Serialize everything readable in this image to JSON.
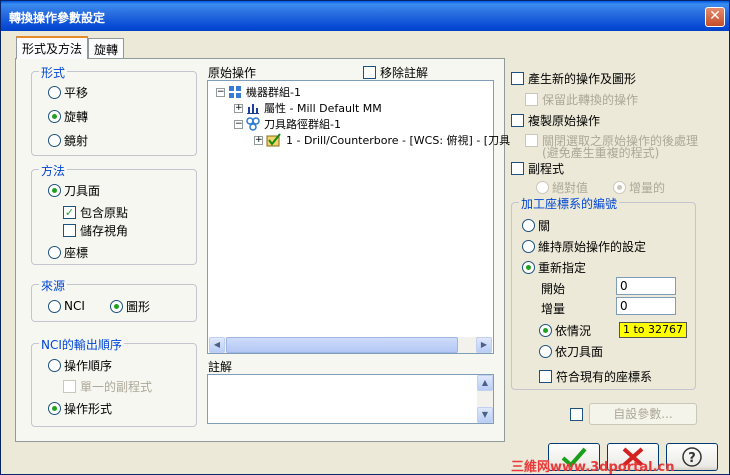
{
  "window": {
    "title": "轉換操作參數設定",
    "close_label": "✕"
  },
  "tabs": [
    {
      "label": "形式及方法"
    },
    {
      "label": "旋轉"
    }
  ],
  "form_group": {
    "title": "形式",
    "options": [
      {
        "label": "平移",
        "selected": false
      },
      {
        "label": "旋轉",
        "selected": true
      },
      {
        "label": "鏡射",
        "selected": false
      }
    ]
  },
  "method_group": {
    "title": "方法",
    "tool_plane": "刀具面",
    "include_origin": "包含原點",
    "save_view": "儲存視角",
    "coords": "座標"
  },
  "source_group": {
    "title": "來源",
    "nci": "NCI",
    "graphics": "圖形"
  },
  "nci_order_group": {
    "title": "NCI的輸出順序",
    "op_order": "操作順序",
    "single_subprogram": "單一的副程式",
    "op_form": "操作形式"
  },
  "original_ops": {
    "label": "原始操作",
    "remove_notes": "移除註解",
    "tree": [
      {
        "text": "機器群組-1",
        "icon": "machine-group-icon"
      },
      {
        "text": "屬性 - Mill Default MM",
        "icon": "properties-icon"
      },
      {
        "text": "刀具路徑群組-1",
        "icon": "toolpath-group-icon"
      },
      {
        "text": "1 - Drill/Counterbore - [WCS: 俯視] - [刀具",
        "icon": "operation-icon"
      }
    ]
  },
  "notes": {
    "label": "註解"
  },
  "right_panel": {
    "create_new_ops": "產生新的操作及圖形",
    "keep_ops": "保留此轉換的操作",
    "copy_ops": "複製原始操作",
    "disable_post_line1": "關閉選取之原始操作的後處理",
    "disable_post_line2": "(避免產生重複的程式)",
    "subprogram": "副程式",
    "absolute": "絕對值",
    "incremental": "增量的"
  },
  "wcs_group": {
    "title": "加工座標系的編號",
    "off": "關",
    "keep_original": "維持原始操作的設定",
    "reassign": "重新指定",
    "start_label": "開始",
    "start_value": "0",
    "increment_label": "增量",
    "increment_value": "0",
    "by_case": "依情況",
    "range": "1 to 32767",
    "by_tool_plane": "依刀具面",
    "match_existing": "符合現有的座標系"
  },
  "bottom": {
    "custom_params": "自設參數...",
    "ok_icon": "check-icon",
    "cancel_icon": "cancel-icon",
    "help_icon": "help-icon"
  },
  "watermark": "三維网www.3dportal.cn"
}
